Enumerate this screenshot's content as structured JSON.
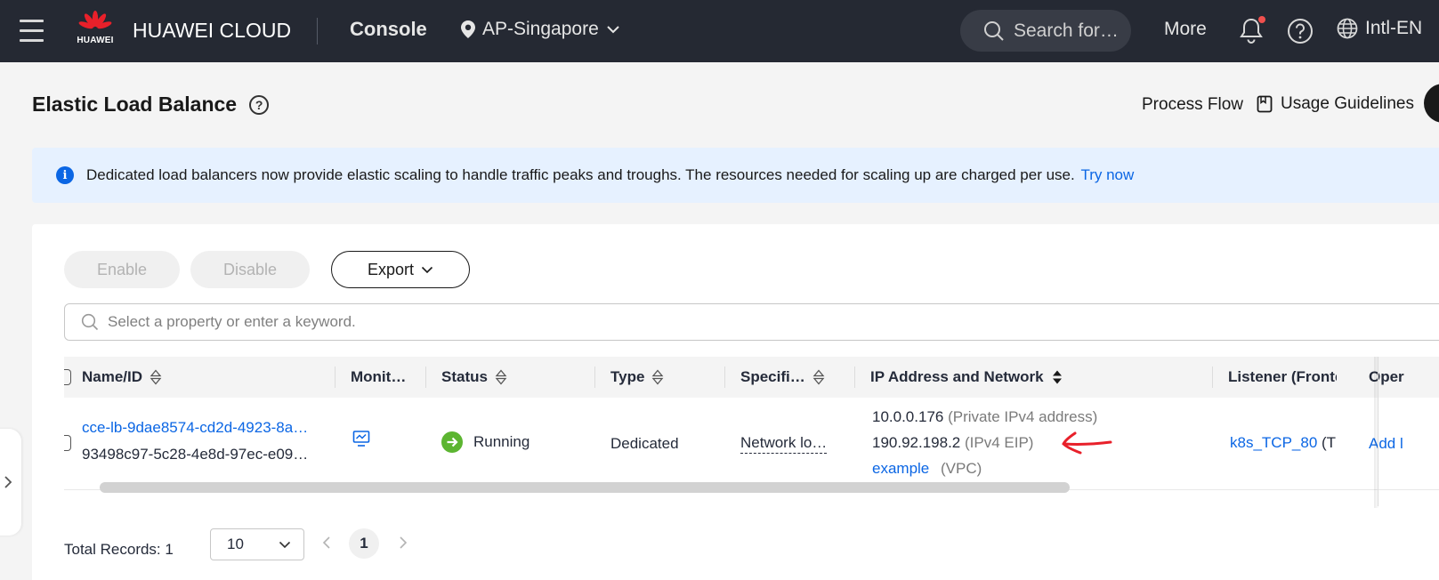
{
  "topbar": {
    "brand": "HUAWEI CLOUD",
    "logo_text": "HUAWEI",
    "console": "Console",
    "region": "AP-Singapore",
    "search_placeholder": "Search for…",
    "more": "More",
    "language": "Intl-EN",
    "icons": [
      "menu-icon",
      "huawei-logo",
      "location-pin-icon",
      "chevron-down-icon",
      "search-icon",
      "bell-icon",
      "help-icon",
      "globe-icon"
    ]
  },
  "page": {
    "title": "Elastic Load Balance",
    "help_mark": "?",
    "process_flow": "Process Flow",
    "usage_guidelines": "Usage Guidelines"
  },
  "banner": {
    "info_mark": "i",
    "text": "Dedicated load balancers now provide elastic scaling to handle traffic peaks and troughs. The resources needed for scaling up are charged per use.",
    "link": "Try now"
  },
  "toolbar": {
    "enable": "Enable",
    "disable": "Disable",
    "export": "Export",
    "search_placeholder": "Select a property or enter a keyword."
  },
  "table": {
    "columns": [
      "Name/ID",
      "Monit…",
      "Status",
      "Type",
      "Specifi…",
      "IP Address and Network",
      "Listener (Fronte",
      "Oper"
    ],
    "rows": [
      {
        "name": "cce-lb-9dae8574-cd2d-4923-8a…",
        "id": "93498c97-5c28-4e8d-97ec-e09…",
        "status": "Running",
        "type": "Dedicated",
        "spec": "Network lo…",
        "private_ip": "10.0.0.176",
        "private_ip_label": "(Private IPv4 address)",
        "eip": "190.92.198.2",
        "eip_label": "(IPv4 EIP)",
        "vpc": "example",
        "vpc_label": "(VPC)",
        "listener": "k8s_TCP_80",
        "listener_suffix": "(T",
        "operation": "Add l"
      }
    ]
  },
  "pagination": {
    "total": "Total Records: 1",
    "page_size": "10",
    "current_page": "1"
  },
  "colors": {
    "topbar_bg": "#252933",
    "link": "#0b66e4",
    "running_green": "#5cb531",
    "banner_bg": "#e6f1ff",
    "annotation_red": "#e8202a"
  }
}
